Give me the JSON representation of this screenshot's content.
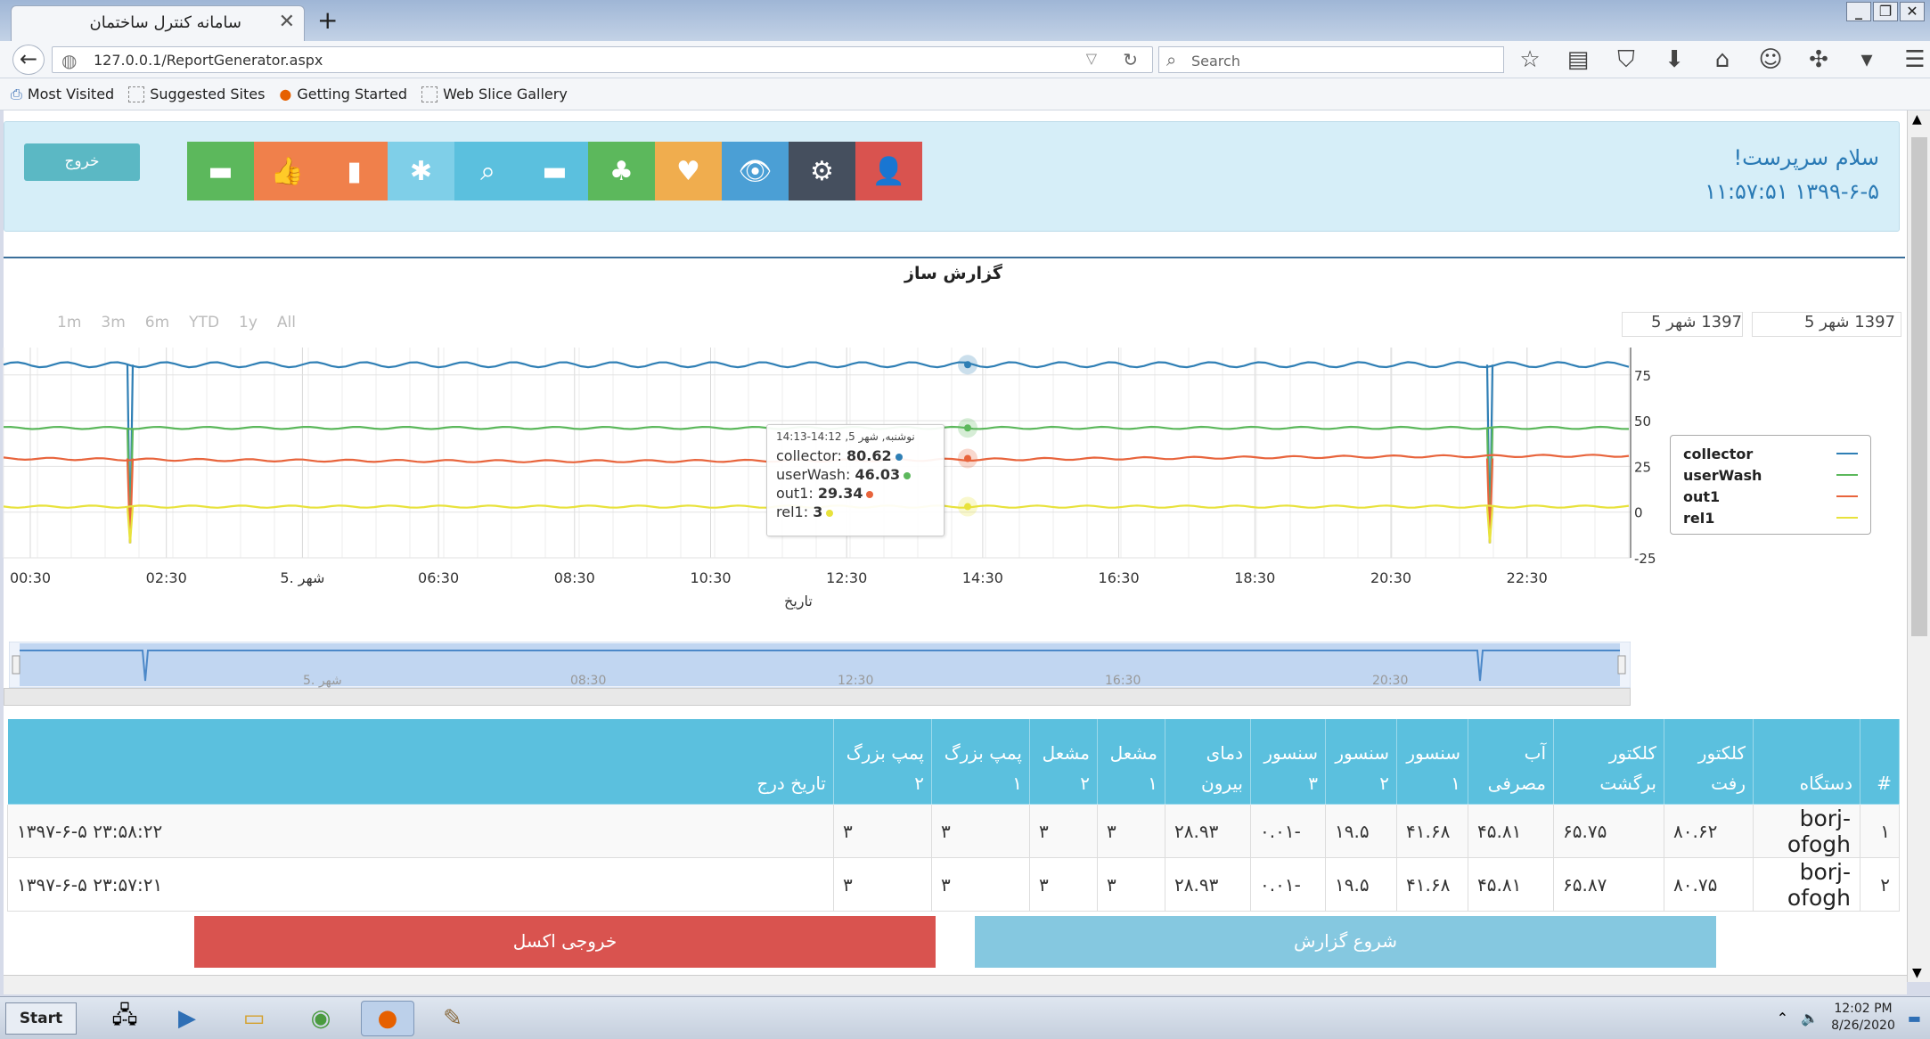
{
  "browser": {
    "tab_title": "سامانه کنترل ساختمان",
    "url": "127.0.0.1/ReportGenerator.aspx",
    "search_placeholder": "Search",
    "bookmarks": [
      "Most Visited",
      "Suggested Sites",
      "Getting Started",
      "Web Slice Gallery"
    ]
  },
  "header": {
    "logout_label": "خروج",
    "greeting": "سلام سرپرست!",
    "datetime": "۱۱:۵۷:۵۱ ۱۳۹۹-۶-۵",
    "toolbar": [
      {
        "name": "user-icon",
        "color": "#d9534f"
      },
      {
        "name": "gear-icon",
        "color": "#454f5e"
      },
      {
        "name": "eye-icon",
        "color": "#4b9fd5"
      },
      {
        "name": "heartbeat-icon",
        "color": "#f0ad4e"
      },
      {
        "name": "sitemap-icon",
        "color": "#5cb85c"
      },
      {
        "name": "printer-icon",
        "color": "#5bc0de"
      },
      {
        "name": "search-icon",
        "color": "#5bc0de"
      },
      {
        "name": "snowflake-icon",
        "color": "#7fcfe8"
      },
      {
        "name": "bar-chart-icon",
        "color": "#f0804b"
      },
      {
        "name": "thumbs-up-icon",
        "color": "#f0804b"
      },
      {
        "name": "printer-icon",
        "color": "#5cb85c"
      }
    ]
  },
  "report": {
    "title": "گزارش ساز",
    "range_buttons": [
      "1m",
      "3m",
      "6m",
      "YTD",
      "1y",
      "All"
    ],
    "date_from": "1397 شهر 5",
    "date_to": "1397 شهر 5",
    "excel_button": "خروجی اکسل",
    "start_button": "شروع گزارش"
  },
  "chart_data": {
    "type": "line",
    "xlabel": "تاریخ",
    "x_ticks": [
      "00:30",
      "02:30",
      "5. شهر",
      "06:30",
      "08:30",
      "10:30",
      "12:30",
      "14:30",
      "16:30",
      "18:30",
      "20:30",
      "22:30"
    ],
    "y_ticks": [
      "75",
      "50",
      "25",
      "0",
      "-25"
    ],
    "ylim": [
      -25,
      90
    ],
    "series": [
      {
        "name": "collector",
        "color": "#2f7fb5",
        "approx_value": 80.62
      },
      {
        "name": "userWash",
        "color": "#5cb85c",
        "approx_value": 46.03
      },
      {
        "name": "out1",
        "color": "#e8643c",
        "approx_value": 29.34
      },
      {
        "name": "rel1",
        "color": "#e8e23c",
        "approx_value": 3
      }
    ],
    "dips": [
      "01:40",
      "21:00"
    ],
    "tooltip": {
      "header": "نوشنبه, شهر 5, 14:12-14:13",
      "rows": [
        {
          "name": "collector",
          "value": "80.62",
          "color": "#2f7fb5"
        },
        {
          "name": "userWash",
          "value": "46.03",
          "color": "#5cb85c"
        },
        {
          "name": "out1",
          "value": "29.34",
          "color": "#e8643c"
        },
        {
          "name": "rel1",
          "value": "3",
          "color": "#e8e23c"
        }
      ]
    },
    "navigator_ticks": [
      "5. شهر",
      "08:30",
      "12:30",
      "16:30",
      "20:30"
    ]
  },
  "table": {
    "headers": [
      "#",
      "دستگاه",
      "کلکتور رفت",
      "کلکتور برگشت",
      "آب مصرفی",
      "سنسور ۱",
      "سنسور ۲",
      "سنسور ۳",
      "دمای بیرون",
      "مشعل ۱",
      "مشعل ۲",
      "پمپ بزرگ ۱",
      "پمپ بزرگ ۲",
      "تاریخ درج"
    ],
    "rows": [
      [
        "۱",
        "borj-ofogh",
        "۸۰.۶۲",
        "۶۵.۷۵",
        "۴۵.۸۱",
        "۴۱.۶۸",
        "۱۹.۵",
        "-۰.۰۱",
        "۲۸.۹۳",
        "۳",
        "۳",
        "۳",
        "۳",
        "۲۳:۵۸:۲۲ ۱۳۹۷-۶-۵"
      ],
      [
        "۲",
        "borj-ofogh",
        "۸۰.۷۵",
        "۶۵.۸۷",
        "۴۵.۸۱",
        "۴۱.۶۸",
        "۱۹.۵",
        "-۰.۰۱",
        "۲۸.۹۳",
        "۳",
        "۳",
        "۳",
        "۳",
        "۲۳:۵۷:۲۱ ۱۳۹۷-۶-۵"
      ]
    ]
  },
  "taskbar": {
    "start_label": "Start",
    "time": "12:02 PM",
    "date": "8/26/2020"
  }
}
